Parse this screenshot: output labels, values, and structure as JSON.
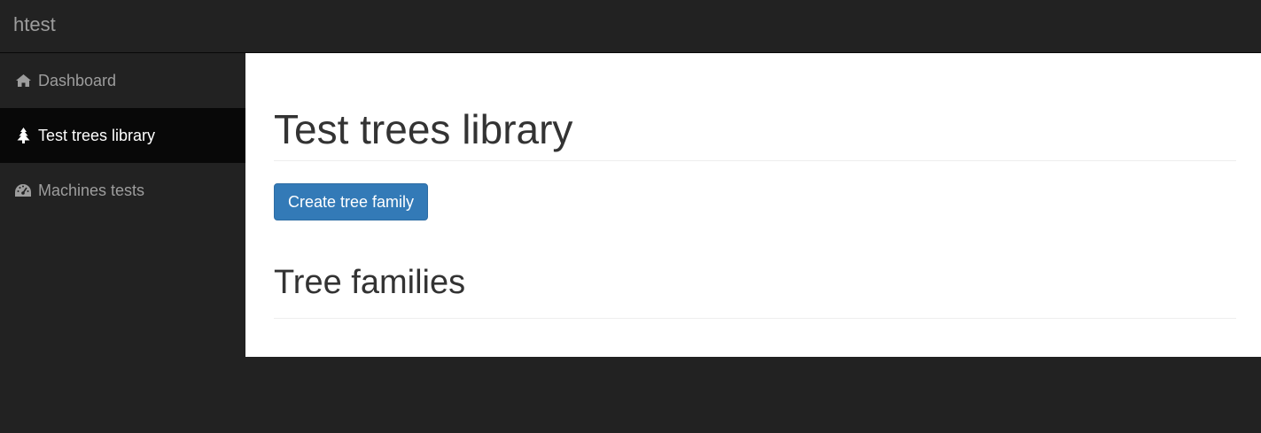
{
  "navbar": {
    "brand": "htest"
  },
  "sidebar": {
    "items": [
      {
        "label": "Dashboard",
        "icon": "home-icon",
        "active": false
      },
      {
        "label": "Test trees library",
        "icon": "tree-icon",
        "active": true
      },
      {
        "label": "Machines tests",
        "icon": "dashboard-gauge-icon",
        "active": false
      }
    ]
  },
  "main": {
    "title": "Test trees library",
    "create_button_label": "Create tree family",
    "section_title": "Tree families"
  },
  "colors": {
    "background": "#222222",
    "active_item_bg": "#080808",
    "inactive_text": "#9d9d9d",
    "primary_button": "#337ab7",
    "heading_text": "#333333"
  }
}
